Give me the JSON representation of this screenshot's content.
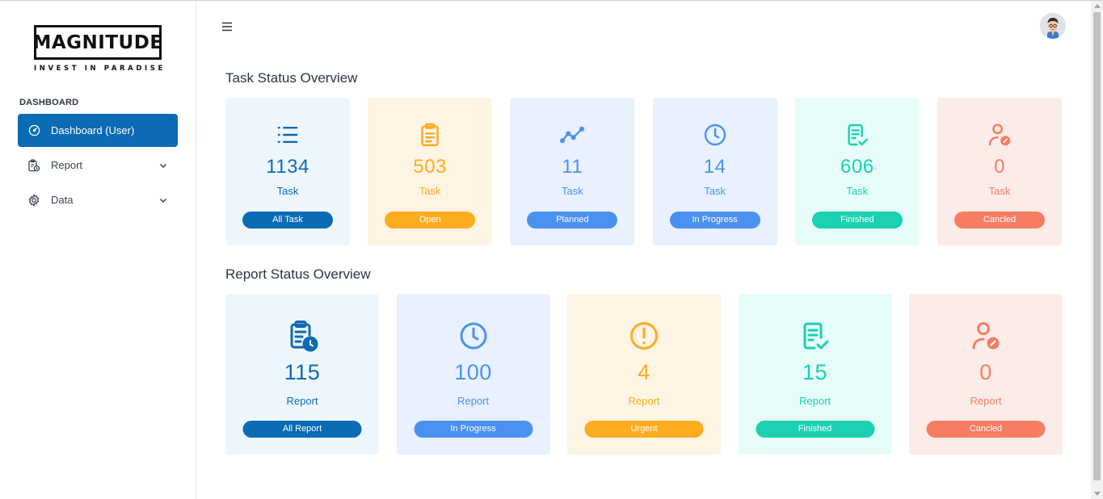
{
  "brand": {
    "name": "MAGNITUDE",
    "tagline": "INVEST IN PARADISE"
  },
  "sidebar": {
    "section": "DASHBOARD",
    "items": [
      {
        "label": "Dashboard (User)",
        "icon": "gauge-icon",
        "active": true
      },
      {
        "label": "Report",
        "icon": "clipboard-clock-icon",
        "expandable": true
      },
      {
        "label": "Data",
        "icon": "gear-icon",
        "expandable": true
      }
    ]
  },
  "header": {
    "menu_icon": "hamburger-icon",
    "avatar": "user-avatar"
  },
  "task_overview": {
    "title": "Task Status Overview",
    "cards": [
      {
        "value": "1134",
        "unit": "Task",
        "button": "All Task",
        "icon": "list-icon",
        "color": "#0b6bb5",
        "bg": "#eef6fd",
        "btn": "#0b6bb5"
      },
      {
        "value": "503",
        "unit": "Task",
        "button": "Open",
        "icon": "clipboard-icon",
        "color": "#fdab1f",
        "bg": "#fef4e4",
        "btn": "#fdab1f"
      },
      {
        "value": "11",
        "unit": "Task",
        "button": "Planned",
        "icon": "trend-icon",
        "color": "#4b91f1",
        "bg": "#e8f1fd",
        "btn": "#4b91f1"
      },
      {
        "value": "14",
        "unit": "Task",
        "button": "In Progress",
        "icon": "clock-icon",
        "color": "#4b91f1",
        "bg": "#e8f1fd",
        "btn": "#4b91f1"
      },
      {
        "value": "606",
        "unit": "Task",
        "button": "Finished",
        "icon": "doc-check-icon",
        "color": "#1bd1b2",
        "bg": "#e6fcf8",
        "btn": "#1bd1b2"
      },
      {
        "value": "0",
        "unit": "Task",
        "button": "Cancled",
        "icon": "user-cancel-icon",
        "color": "#f67d63",
        "bg": "#fcece8",
        "btn": "#f67d63"
      }
    ]
  },
  "report_overview": {
    "title": "Report Status Overview",
    "cards": [
      {
        "value": "115",
        "unit": "Report",
        "button": "All Report",
        "icon": "clipboard-clock-icon",
        "color": "#0b6bb5",
        "bg": "#eef6fd",
        "btn": "#0b6bb5"
      },
      {
        "value": "100",
        "unit": "Report",
        "button": "In Progress",
        "icon": "clock-icon",
        "color": "#4b91f1",
        "bg": "#e8f1fd",
        "btn": "#4b91f1"
      },
      {
        "value": "4",
        "unit": "Report",
        "button": "Urgent",
        "icon": "alert-icon",
        "color": "#fdab1f",
        "bg": "#fef4e4",
        "btn": "#fdab1f"
      },
      {
        "value": "15",
        "unit": "Report",
        "button": "Finished",
        "icon": "doc-check-icon",
        "color": "#1bd1b2",
        "bg": "#e6fcf8",
        "btn": "#1bd1b2"
      },
      {
        "value": "0",
        "unit": "Report",
        "button": "Cancled",
        "icon": "user-cancel-icon",
        "color": "#f67d63",
        "bg": "#fcece8",
        "btn": "#f67d63"
      }
    ]
  }
}
